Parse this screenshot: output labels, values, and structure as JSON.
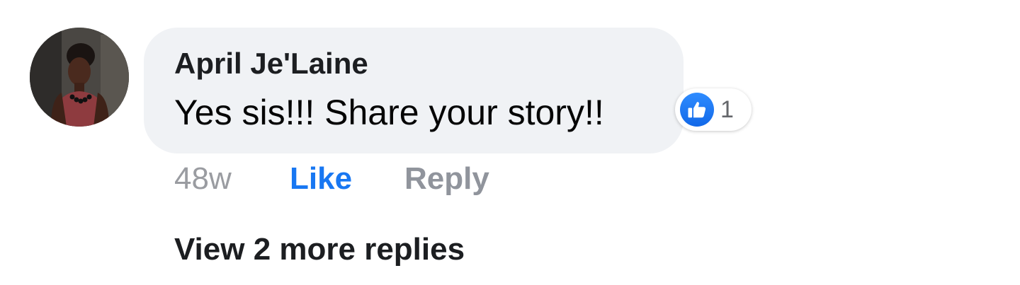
{
  "comment": {
    "author": "April Je'Laine",
    "text": "Yes sis!!! Share your story!!",
    "timestamp": "48w",
    "reaction_count": "1",
    "reaction_icon": "thumbs-up-icon"
  },
  "actions": {
    "like_label": "Like",
    "reply_label": "Reply"
  },
  "replies": {
    "view_more_label": "View 2 more replies"
  },
  "colors": {
    "bubble_bg": "#f0f2f5",
    "like_blue": "#1877f2",
    "muted_gray": "#90949c",
    "text_dark": "#1c1e21"
  }
}
